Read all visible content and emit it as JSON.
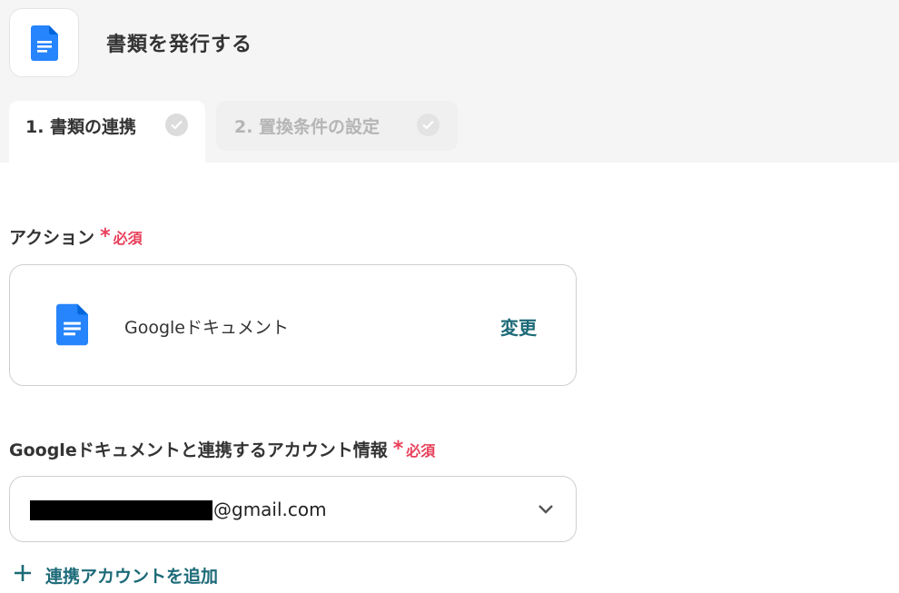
{
  "header": {
    "title": "書類を発行する",
    "app_icon": "google-docs-icon"
  },
  "tabs": [
    {
      "label": "1. 書類の連携",
      "status_icon": "check-circle-icon",
      "active": true
    },
    {
      "label": "2. 置換条件の設定",
      "status_icon": "check-circle-icon",
      "active": false
    }
  ],
  "action_section": {
    "label": "アクション",
    "required_mark": "*",
    "required_text": "必須",
    "selected_app": "Googleドキュメント",
    "app_icon": "google-docs-icon",
    "change_label": "変更"
  },
  "account_section": {
    "label": "Googleドキュメントと連携するアカウント情報",
    "required_mark": "*",
    "required_text": "必須",
    "email_suffix": "@gmail.com",
    "add_account_label": "連携アカウントを追加"
  },
  "colors": {
    "accent": "#1c6a78",
    "required": "#e8405a",
    "docs_blue": "#2684fc"
  }
}
